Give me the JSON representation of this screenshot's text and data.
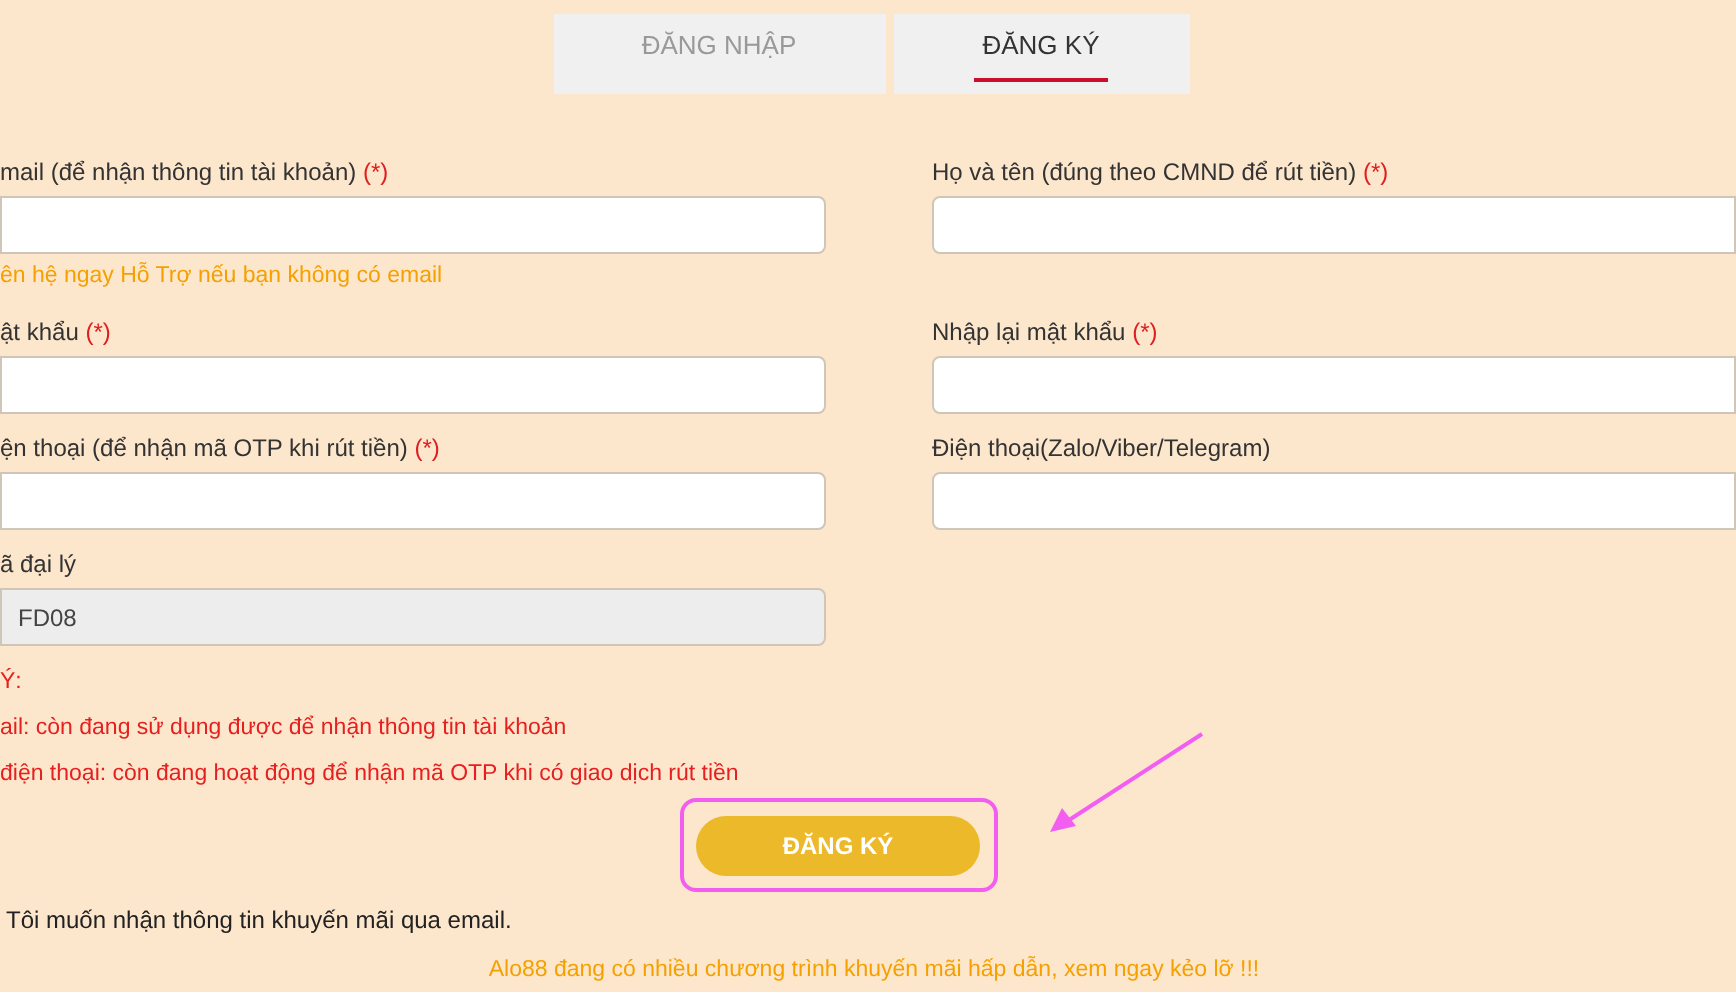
{
  "tabs": [
    {
      "label": "ĐĂNG NHẬP",
      "selected": false
    },
    {
      "label": "ĐĂNG KÝ",
      "selected": true
    }
  ],
  "rows": [
    {
      "left": {
        "label": "mail (để nhận thông tin tài khoản)",
        "required_mark": "(*)"
      },
      "right": {
        "label": "Họ và tên (đúng theo CMND để rút tiền)",
        "required_mark": "(*)"
      },
      "hint": "ên hệ ngay Hỗ Trợ nếu bạn không có email"
    },
    {
      "left": {
        "label": "ật khẩu",
        "required_mark": "(*)"
      },
      "right": {
        "label": "Nhập lại mật khẩu",
        "required_mark": "(*)"
      }
    },
    {
      "left": {
        "label": "ện thoại (để nhận mã OTP khi rút tiền)",
        "required_mark": "(*)"
      },
      "right": {
        "label": "Điện thoại(Zalo/Viber/Telegram)"
      }
    },
    {
      "left": {
        "label": "ã đại lý",
        "value": "FD08",
        "disabled": true
      }
    }
  ],
  "notes": [
    "Ý:",
    "ail: còn đang sử dụng được để nhận thông tin tài khoản",
    "điện thoại: còn đang hoạt động để nhận mã OTP khi có giao dịch rút tiền"
  ],
  "submit_button": {
    "label": "ĐĂNG KÝ"
  },
  "promo_opt_in": "Tôi muốn nhận thông tin khuyến mãi qua email.",
  "promo_banner": "Alo88 đang có nhiều chương trình khuyến mãi hấp dẫn, xem ngay kẻo lỡ !!!"
}
